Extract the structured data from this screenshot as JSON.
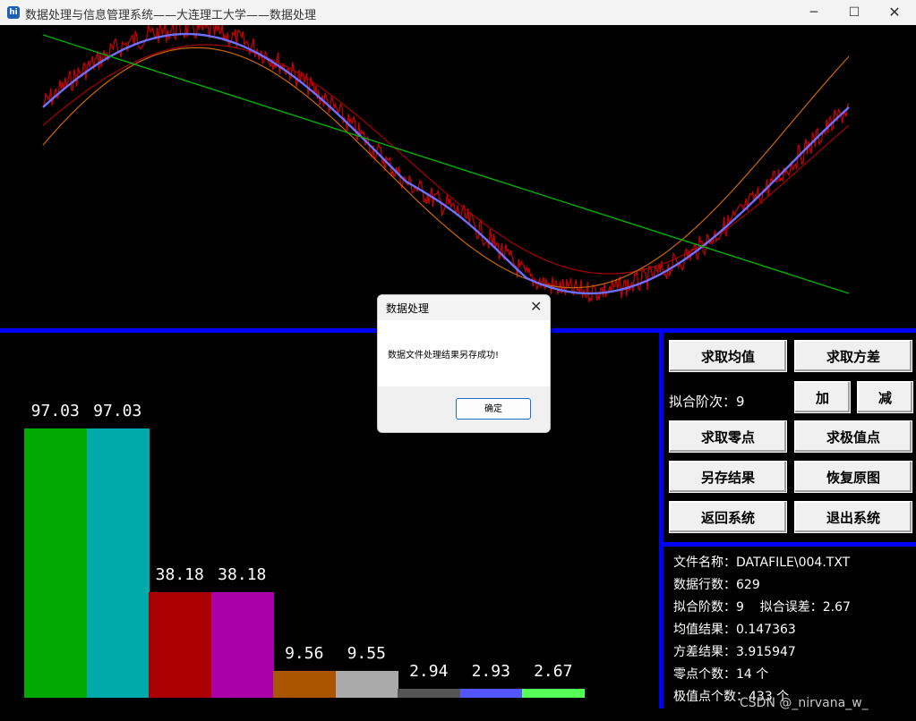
{
  "window": {
    "title": "数据处理与信息管理系统——大连理工大学——数据处理",
    "app_icon": "app-icon",
    "minimize": "─",
    "maximize": "☐",
    "close": "✕"
  },
  "bars": [
    {
      "label": "97.03",
      "value": 97.03,
      "color": "#00aa00"
    },
    {
      "label": "97.03",
      "value": 97.03,
      "color": "#00aaaa"
    },
    {
      "label": "38.18",
      "value": 38.18,
      "color": "#aa0000"
    },
    {
      "label": "38.18",
      "value": 38.18,
      "color": "#aa00aa"
    },
    {
      "label": "9.56",
      "value": 9.56,
      "color": "#aa5500"
    },
    {
      "label": "9.55",
      "value": 9.55,
      "color": "#aaaaaa"
    },
    {
      "label": "2.94",
      "value": 2.94,
      "color": "#555555"
    },
    {
      "label": "2.93",
      "value": 2.93,
      "color": "#5555ff"
    },
    {
      "label": "2.67",
      "value": 2.67,
      "color": "#55ff55"
    }
  ],
  "buttons": {
    "mean": "求取均值",
    "variance": "求取方差",
    "add": "加",
    "subtract": "减",
    "zeros": "求取零点",
    "extrema": "求极值点",
    "save": "另存结果",
    "restore": "恢复原图",
    "back": "返回系统",
    "exit": "退出系统"
  },
  "fit_order_label": "拟合阶次：9",
  "info": {
    "file_name": "文件名称：DATAFILE\\004.TXT",
    "row_count": "数据行数：629",
    "fit_order": "拟合阶数：9",
    "fit_error": "拟合误差：2.67",
    "mean_result": "均值结果：0.147363",
    "variance_result": "方差结果：3.915947",
    "zero_count": "零点个数：14 个",
    "extrema_count": "极值点个数：433 个"
  },
  "dialog": {
    "title": "数据处理",
    "message": "数据文件处理结果另存成功!",
    "ok": "确定",
    "close": "✕"
  },
  "watermark": "CSDN @_nirvana_w_",
  "colors": {
    "divider": "#0000ff",
    "background": "#000000",
    "noisy": "#cc0000",
    "fit_blue": "#6f6fff",
    "fit_green": "#00b000",
    "fit_orange": "#cc6600",
    "fit_dark_red": "#aa0000"
  }
}
